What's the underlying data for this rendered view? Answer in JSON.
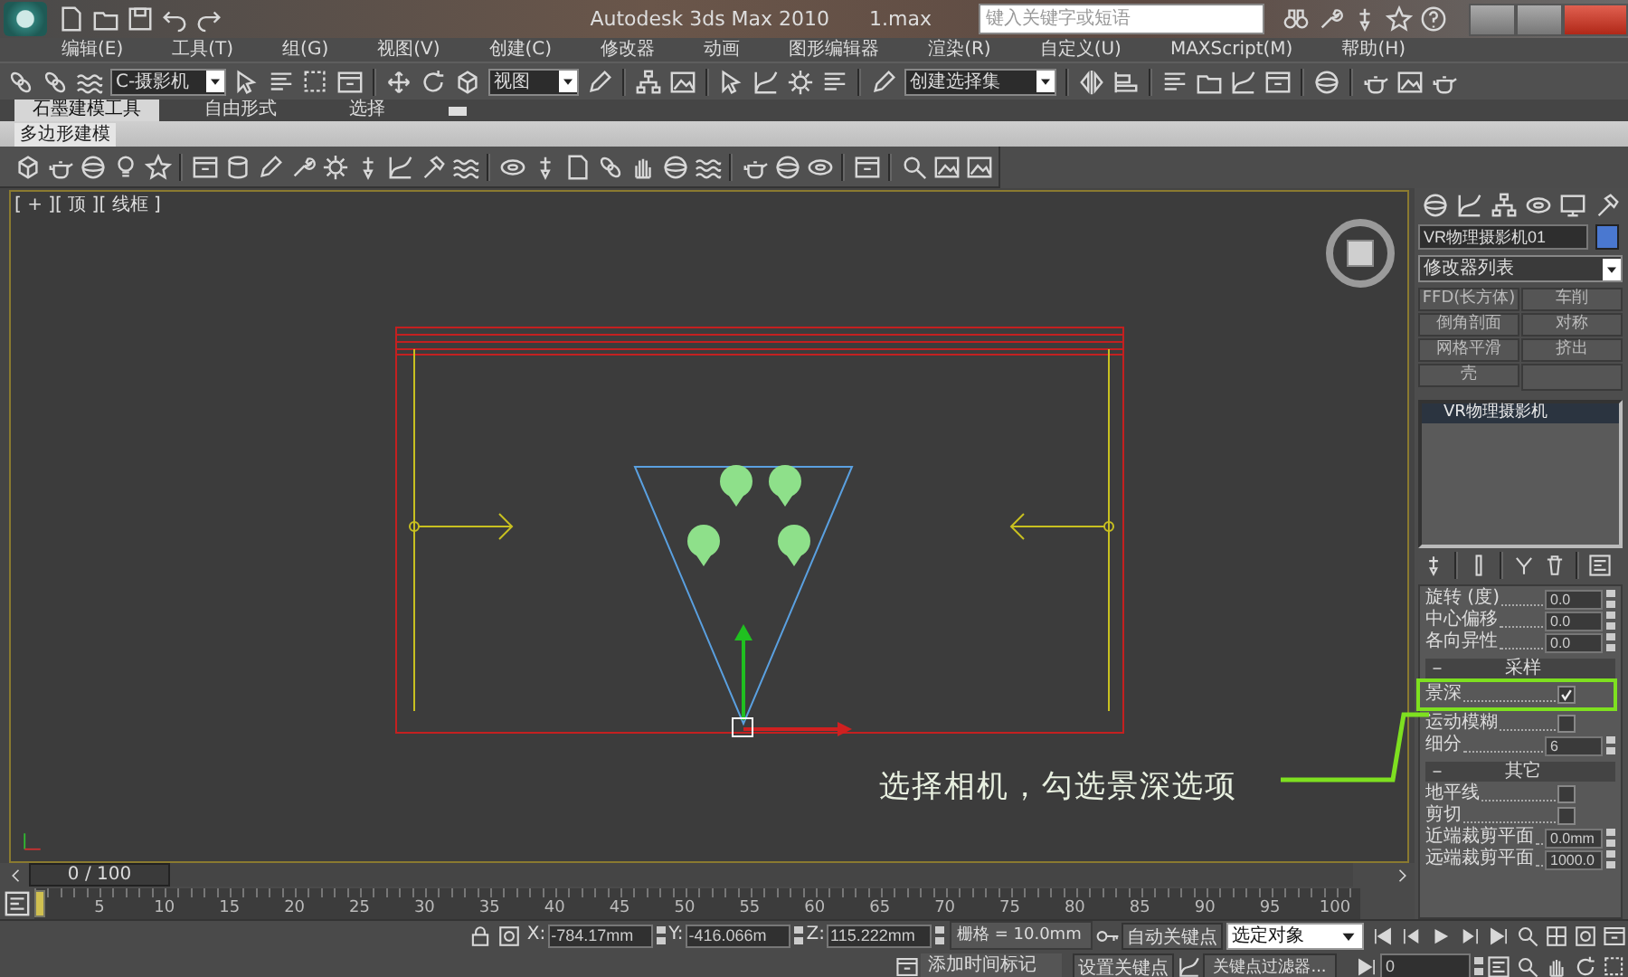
{
  "title_bar": {
    "app_title": "Autodesk 3ds Max  2010",
    "file_name": "1.max",
    "search": {
      "placeholder": "键入关键字或短语"
    }
  },
  "menu": [
    "编辑(E)",
    "工具(T)",
    "组(G)",
    "视图(V)",
    "创建(C)",
    "修改器",
    "动画",
    "图形编辑器",
    "渲染(R)",
    "自定义(U)",
    "MAXScript(M)",
    "帮助(H)"
  ],
  "toolbar": {
    "selection_filter": "C-摄影机",
    "reference_coordinate": "视图",
    "named_selection": "创建选择集"
  },
  "ribbon": {
    "tabs": [
      {
        "label": "石墨建模工具",
        "selected": true
      },
      {
        "label": "自由形式",
        "selected": false
      },
      {
        "label": "选择",
        "selected": false
      }
    ],
    "panel_tab": "多边形建模"
  },
  "viewport": {
    "label": "[ + ][ 顶 ][ 线框 ]",
    "annotation": "选择相机，勾选景深选项"
  },
  "command_panel": {
    "object_name": "VR物理摄影机01",
    "modifier_list": "修改器列表",
    "modifier_buttons": [
      "FFD(长方体)",
      "车削",
      "倒角剖面",
      "对称",
      "网格平滑",
      "挤出",
      "壳"
    ],
    "stack": [
      {
        "label": "VR物理摄影机",
        "selected": true
      }
    ],
    "parameters": [
      {
        "kind": "spinner",
        "label": "旋转 (度)",
        "value": "0.0"
      },
      {
        "kind": "spinner",
        "label": "中心偏移",
        "value": "0.0"
      },
      {
        "kind": "spinner",
        "label": "各向异性",
        "value": "0.0"
      }
    ],
    "sections": [
      {
        "title": "采样",
        "expanded": true,
        "rows": [
          {
            "kind": "checkbox",
            "label": "景深",
            "checked": true,
            "highlighted": true
          },
          {
            "kind": "checkbox",
            "label": "运动模糊",
            "checked": false,
            "highlighted": false
          },
          {
            "kind": "spinner",
            "label": "细分",
            "value": "6",
            "highlighted": false
          }
        ]
      },
      {
        "title": "其它",
        "expanded": true,
        "rows": [
          {
            "kind": "checkbox",
            "label": "地平线",
            "checked": false,
            "highlighted": false
          },
          {
            "kind": "checkbox",
            "label": "剪切",
            "checked": false,
            "highlighted": false
          },
          {
            "kind": "spinner",
            "label": "近端裁剪平面",
            "value": "0.0mm",
            "highlighted": false
          },
          {
            "kind": "spinner",
            "label": "远端裁剪平面",
            "value": "1000.0",
            "highlighted": false
          }
        ]
      }
    ]
  },
  "timeline": {
    "frame_counter": "0 / 100",
    "level": 0,
    "ticks": [
      "5",
      "10",
      "15",
      "20",
      "25",
      "30",
      "35",
      "40",
      "45",
      "50",
      "55",
      "60",
      "65",
      "70",
      "75",
      "80",
      "85",
      "90",
      "95",
      "100"
    ]
  },
  "status_bar": {
    "coordinates": [
      {
        "axis": "X:",
        "value": "-784.17mm"
      },
      {
        "axis": "Y:",
        "value": "-416.066m"
      },
      {
        "axis": "Z:",
        "value": "115.222mm"
      }
    ],
    "grid": "栅格 = 10.0mm",
    "auto_key": "自动关键点",
    "key_mode": "选定对象",
    "set_key": "设置关键点",
    "key_filters": "关键点过滤器...",
    "add_time_tag": "添加时间标记",
    "frame": "0"
  }
}
